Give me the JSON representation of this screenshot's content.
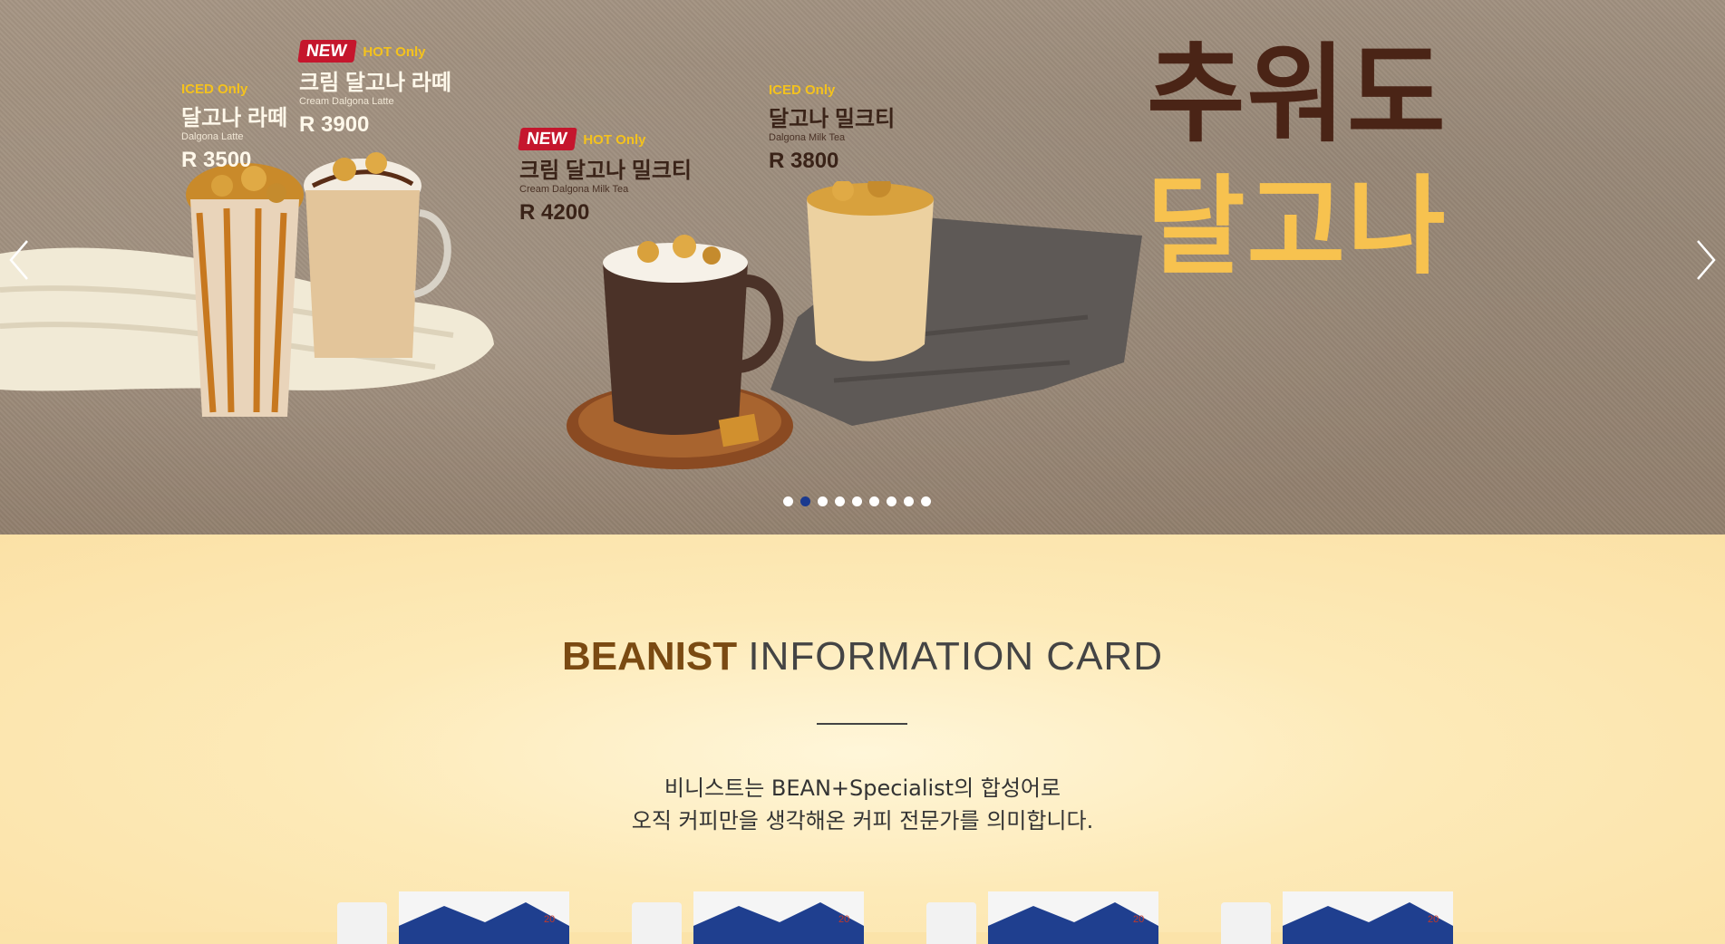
{
  "hero": {
    "headline_line1": "추워도",
    "headline_line2": "달고나",
    "prev_label": "previous",
    "next_label": "next",
    "products": [
      {
        "tag": "ICED Only",
        "name": "달고나 라떼",
        "eng": "Dalgona Latte",
        "price": "R 3500",
        "new": false
      },
      {
        "badge": "NEW",
        "tag": "HOT Only",
        "name": "크림 달고나 라떼",
        "eng": "Cream Dalgona Latte",
        "price": "R 3900",
        "new": true
      },
      {
        "badge": "NEW",
        "tag": "HOT Only",
        "name": "크림 달고나 밀크티",
        "eng": "Cream Dalgona Milk Tea",
        "price": "R 4200",
        "new": true
      },
      {
        "tag": "ICED Only",
        "name": "달고나 밀크티",
        "eng": "Dalgona Milk Tea",
        "price": "R 3800",
        "new": false
      }
    ],
    "slide_count": 9,
    "active_slide": 2,
    "colors": {
      "active_dot": "#1b3a8f",
      "dot": "#ffffff",
      "headline_brown": "#4a2416",
      "headline_yellow": "#f7c24f",
      "new_badge": "#c5162d",
      "tag_yellow": "#f4c21d"
    }
  },
  "info": {
    "title_strong": "BEANIST",
    "title_light": "INFORMATION CARD",
    "desc_line1": "비니스트는 BEAN+Specialist의 합성어로",
    "desc_line2": "오직 커피만을 생각해온 커피 전문가를 의미합니다.",
    "card_count_label": "20",
    "colors": {
      "background": "#fbe3a9",
      "title_strong": "#7a4a12",
      "box_blue": "#1f3f8f"
    }
  }
}
